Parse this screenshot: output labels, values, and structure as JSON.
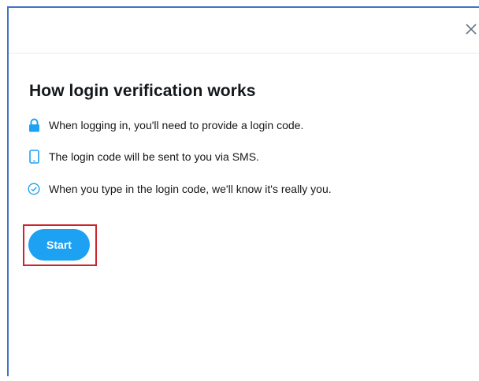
{
  "dialog": {
    "close_icon": "close-icon",
    "title": "How login verification works",
    "features": [
      {
        "icon": "lock-icon",
        "text": "When logging in, you'll need to provide a login code."
      },
      {
        "icon": "phone-icon",
        "text": "The login code will be sent to you via SMS."
      },
      {
        "icon": "check-circle-icon",
        "text": "When you type in the login code, we'll know it's really you."
      }
    ],
    "start_label": "Start"
  },
  "colors": {
    "accent": "#1da1f2",
    "highlight": "#c9252e",
    "frame": "#3f74c4",
    "text": "#14171a"
  }
}
